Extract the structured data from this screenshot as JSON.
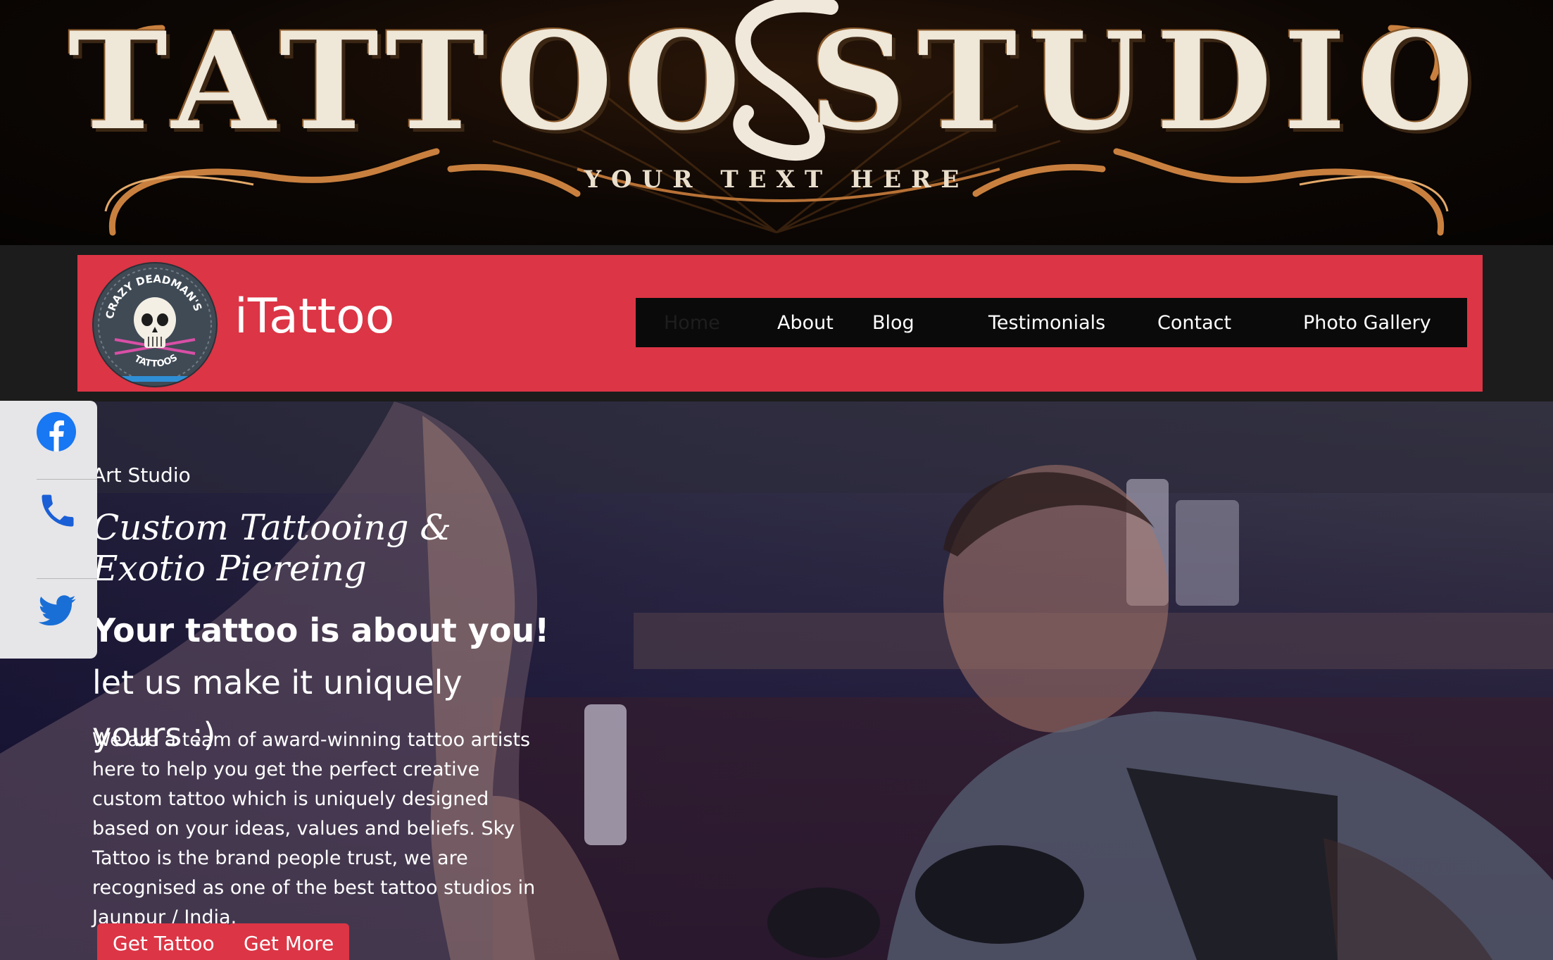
{
  "banner": {
    "title": "TATTOO STUDIO",
    "subtitle": "YOUR TEXT HERE"
  },
  "header": {
    "brand": "iTattoo",
    "logo": {
      "top_text": "CRAZY DEADMAN'S",
      "bottom_text": "TATTOOS"
    },
    "nav": [
      {
        "label": "Home",
        "active": true
      },
      {
        "label": "About"
      },
      {
        "label": "Blog"
      },
      {
        "label": "Testimonials"
      },
      {
        "label": "Contact"
      },
      {
        "label": "Photo Gallery"
      }
    ]
  },
  "social": [
    {
      "icon": "facebook-icon",
      "color": "#1877f2"
    },
    {
      "icon": "phone-icon",
      "color": "#1a5fd6"
    },
    {
      "icon": "twitter-icon",
      "color": "#1a6fd6"
    }
  ],
  "hero": {
    "kicker": "Art Studio",
    "title": "Custom Tattooing & Exotio Piereing",
    "tagline_bold": "Your tattoo is about you!",
    "tagline_rest": " let us make it uniquely yours :)",
    "description": "We are a team of award-winning tattoo artists here to help you get the perfect creative custom tattoo which is uniquely designed based on your ideas, values and beliefs. Sky Tattoo is the brand people trust, we are recognised as one of the best tattoo studios in Jaunpur / India.",
    "buttons": [
      {
        "label": "Get Tattoo"
      },
      {
        "label": "Get More"
      }
    ]
  },
  "colors": {
    "accent": "#dc3545",
    "nav_bg": "#0a0a0a",
    "active_nav": "#1e1e1e"
  }
}
